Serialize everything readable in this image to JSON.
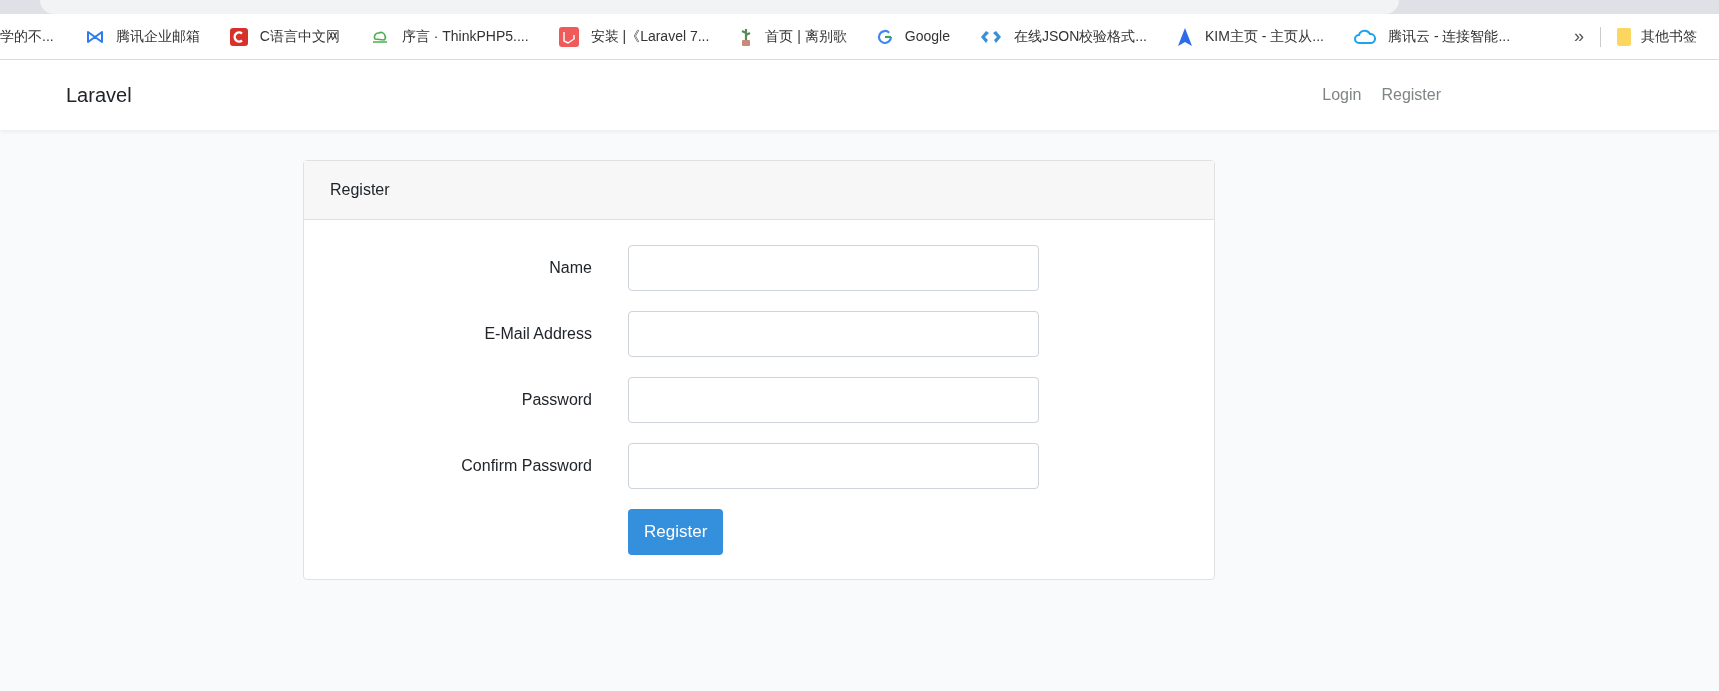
{
  "bookmarks": [
    {
      "label": "学的不..."
    },
    {
      "label": "腾讯企业邮箱"
    },
    {
      "label": "C语言中文网"
    },
    {
      "label": "序言 · ThinkPHP5...."
    },
    {
      "label": "安装 |《Laravel 7..."
    },
    {
      "label": "首页 | 离别歌"
    },
    {
      "label": "Google"
    },
    {
      "label": "在线JSON校验格式..."
    },
    {
      "label": "KIM主页 - 主页从..."
    },
    {
      "label": "腾讯云 - 连接智能..."
    }
  ],
  "more_bookmarks": "»",
  "other_bookmarks": "其他书签",
  "navbar": {
    "brand": "Laravel",
    "links": [
      "Login",
      "Register"
    ]
  },
  "card": {
    "title": "Register",
    "fields": [
      {
        "label": "Name"
      },
      {
        "label": "E-Mail Address"
      },
      {
        "label": "Password"
      },
      {
        "label": "Confirm Password"
      }
    ],
    "submit": "Register"
  }
}
